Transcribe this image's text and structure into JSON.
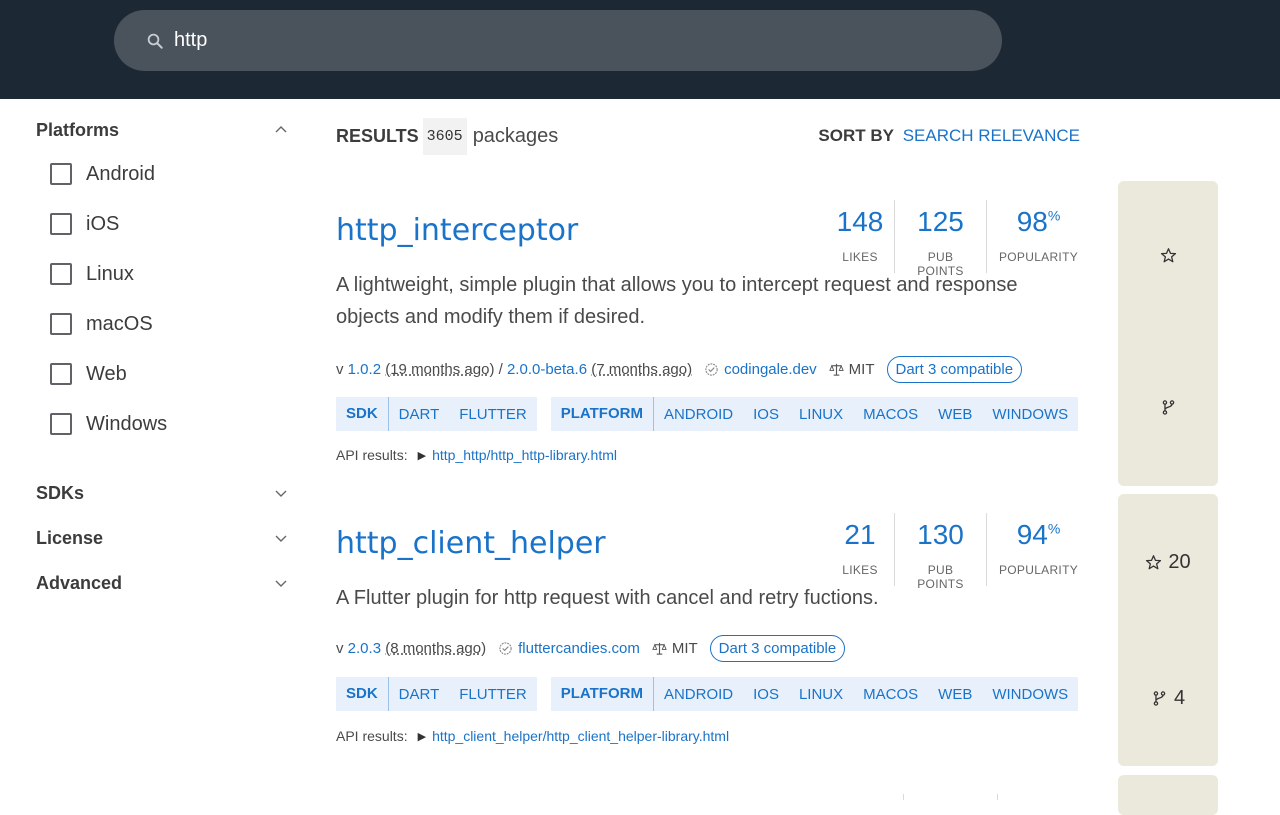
{
  "search": {
    "query": "http"
  },
  "sidebar": {
    "platforms_label": "Platforms",
    "platforms": [
      "Android",
      "iOS",
      "Linux",
      "macOS",
      "Web",
      "Windows"
    ],
    "sdks_label": "SDKs",
    "license_label": "License",
    "advanced_label": "Advanced"
  },
  "results": {
    "label": "RESULTS",
    "count": "3605",
    "suffix": "packages",
    "sort_label": "SORT BY",
    "sort_value": "SEARCH RELEVANCE"
  },
  "packages": [
    {
      "name": "http_interceptor",
      "likes": "148",
      "likes_label": "LIKES",
      "points": "125",
      "points_label": "PUB POINTS",
      "popularity": "98",
      "popularity_unit": "%",
      "popularity_label": "POPULARITY",
      "description": "A lightweight, simple plugin that allows you to intercept request and response objects and modify them if desired.",
      "version_prefix": "v ",
      "version": "1.0.2",
      "version_age": "(19 months ago)",
      "prerelease_sep": " / ",
      "prerelease": "2.0.0-beta.6",
      "prerelease_age": "(7 months ago)",
      "publisher": "codingale.dev",
      "license": "MIT",
      "dart3": "Dart 3 compatible",
      "sdk_label": "SDK",
      "sdks": [
        "DART",
        "FLUTTER"
      ],
      "platform_label": "PLATFORM",
      "platforms": [
        "ANDROID",
        "IOS",
        "LINUX",
        "MACOS",
        "WEB",
        "WINDOWS"
      ],
      "api_label": "API results:",
      "api_link": "http_http/http_http-library.html",
      "side_likes": "",
      "side_forks": ""
    },
    {
      "name": "http_client_helper",
      "likes": "21",
      "likes_label": "LIKES",
      "points": "130",
      "points_label": "PUB POINTS",
      "popularity": "94",
      "popularity_unit": "%",
      "popularity_label": "POPULARITY",
      "description": "A Flutter plugin for http request with cancel and retry fuctions.",
      "version_prefix": "v ",
      "version": "2.0.3",
      "version_age": "(8 months ago)",
      "publisher": "fluttercandies.com",
      "license": "MIT",
      "dart3": "Dart 3 compatible",
      "sdk_label": "SDK",
      "sdks": [
        "DART",
        "FLUTTER"
      ],
      "platform_label": "PLATFORM",
      "platforms": [
        "ANDROID",
        "IOS",
        "LINUX",
        "MACOS",
        "WEB",
        "WINDOWS"
      ],
      "api_label": "API results:",
      "api_link": "http_client_helper/http_client_helper-library.html",
      "side_likes": "20",
      "side_forks": "4"
    }
  ]
}
